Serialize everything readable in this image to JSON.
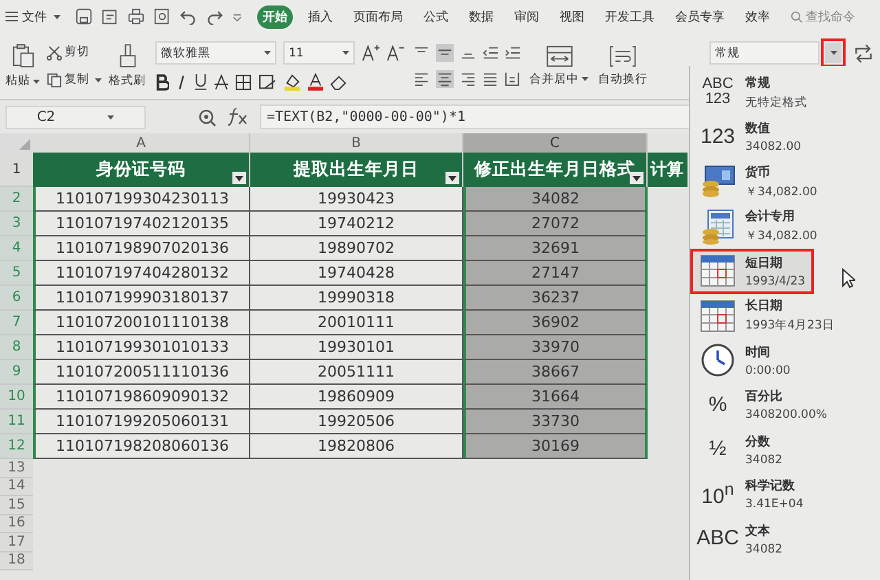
{
  "menu": {
    "label": "文件"
  },
  "tabs": [
    {
      "label": "开始",
      "selected": true
    },
    {
      "label": "插入",
      "selected": false
    },
    {
      "label": "页面布局",
      "selected": false
    },
    {
      "label": "公式",
      "selected": false
    },
    {
      "label": "数据",
      "selected": false
    },
    {
      "label": "审阅",
      "selected": false
    },
    {
      "label": "视图",
      "selected": false
    },
    {
      "label": "开发工具",
      "selected": false
    },
    {
      "label": "会员专享",
      "selected": false
    },
    {
      "label": "效率",
      "selected": false
    }
  ],
  "search": {
    "placeholder": "查找命令"
  },
  "ribbon": {
    "paste": "粘贴",
    "cut": "剪切",
    "copy": "复制",
    "format_painter": "格式刷",
    "font_name": "微软雅黑",
    "font_size": "11",
    "merge": "合并居中",
    "wrap": "自动换行",
    "number_format": "常规"
  },
  "formula_bar": {
    "cell_ref": "C2",
    "formula": "=TEXT(B2,\"0000-00-00\")*1"
  },
  "sheet": {
    "columns": [
      {
        "letter": "A",
        "selected": false
      },
      {
        "letter": "B",
        "selected": false
      },
      {
        "letter": "C",
        "selected": true
      }
    ],
    "header_row_number": "1",
    "header": [
      "身份证号码",
      "提取出生年月日",
      "修正出生年月日格式",
      "计算"
    ],
    "rows": [
      {
        "number": "2",
        "cells": [
          "110107199304230113",
          "19930423",
          "34082"
        ]
      },
      {
        "number": "3",
        "cells": [
          "110107197402120135",
          "19740212",
          "27072"
        ]
      },
      {
        "number": "4",
        "cells": [
          "110107198907020136",
          "19890702",
          "32691"
        ]
      },
      {
        "number": "5",
        "cells": [
          "110107197404280132",
          "19740428",
          "27147"
        ]
      },
      {
        "number": "6",
        "cells": [
          "110107199903180137",
          "19990318",
          "36237"
        ]
      },
      {
        "number": "7",
        "cells": [
          "110107200101110138",
          "20010111",
          "36902"
        ]
      },
      {
        "number": "8",
        "cells": [
          "110107199301010133",
          "19930101",
          "33970"
        ]
      },
      {
        "number": "9",
        "cells": [
          "110107200511110136",
          "20051111",
          "38667"
        ]
      },
      {
        "number": "10",
        "cells": [
          "110107198609090132",
          "19860909",
          "31664"
        ]
      },
      {
        "number": "11",
        "cells": [
          "110107199205060131",
          "19920506",
          "33730"
        ]
      },
      {
        "number": "12",
        "cells": [
          "110107198208060136",
          "19820806",
          "30169"
        ]
      }
    ],
    "empty_rows": [
      "13",
      "14",
      "15",
      "16",
      "17",
      "18"
    ]
  },
  "format_menu": [
    {
      "kind": "text_icon",
      "icon_text": "ABC 123",
      "name": "常规",
      "example": "无特定格式",
      "selected": false
    },
    {
      "kind": "text_icon",
      "icon_text": "123",
      "name": "数值",
      "example": "34082.00",
      "selected": false
    },
    {
      "kind": "currency",
      "name": "货币",
      "example": "￥34,082.00",
      "selected": false
    },
    {
      "kind": "accounting",
      "name": "会计专用",
      "example": "￥34,082.00",
      "selected": false
    },
    {
      "kind": "calendar",
      "name": "短日期",
      "example": "1993/4/23",
      "selected": true
    },
    {
      "kind": "calendar",
      "name": "长日期",
      "example": "1993年4月23日",
      "selected": false
    },
    {
      "kind": "clock",
      "name": "时间",
      "example": "0:00:00",
      "selected": false
    },
    {
      "kind": "text_icon",
      "icon_text": "%",
      "name": "百分比",
      "example": "3408200.00%",
      "selected": false
    },
    {
      "kind": "text_icon",
      "icon_text": "½",
      "name": "分数",
      "example": "34082",
      "selected": false
    },
    {
      "kind": "text_icon",
      "icon_text": "10$^{n}$",
      "name": "科学记数",
      "example": "3.41E+04",
      "selected": false
    },
    {
      "kind": "text_icon",
      "icon_text": "ABC",
      "name": "文本",
      "example": "34082",
      "selected": false
    }
  ]
}
